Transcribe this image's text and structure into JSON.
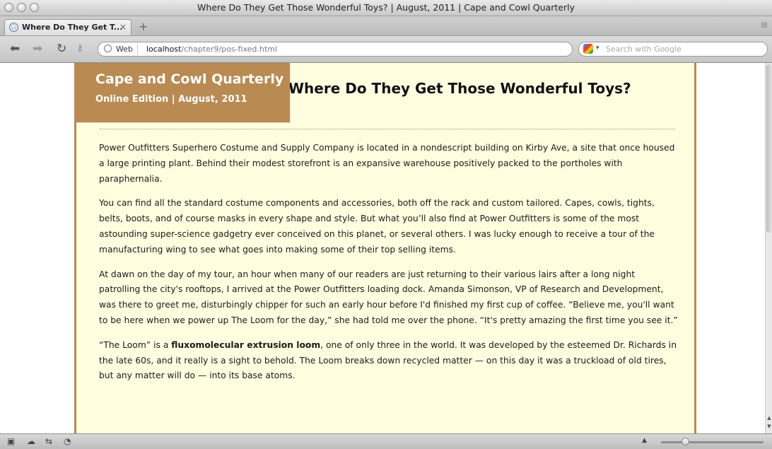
{
  "window": {
    "title": "Where Do They Get Those Wonderful Toys? | August, 2011 | Cape and Cowl Quarterly"
  },
  "tabs": [
    {
      "label": "Where Do They Get T...",
      "close": "×"
    }
  ],
  "tabbar": {
    "new_tab": "+"
  },
  "nav": {
    "back": "⬅",
    "forward": "➡",
    "reload": "↻",
    "site_badge": "Web",
    "url_host": "localhost",
    "url_path": "/chapter9/pos-fixed.html",
    "search_placeholder": "Search with Google"
  },
  "masthead": {
    "title": "Cape and Cowl Quarterly",
    "subtitle": "Online Edition | August, 2011"
  },
  "article": {
    "title": "Where Do They Get Those Wonderful Toys?",
    "paragraphs": [
      "Power Outfitters Superhero Costume and Supply Company is located in a nondescript building on Kirby Ave, a site that once housed a large printing plant. Behind their modest storefront is an expansive warehouse positively packed to the portholes with paraphernalia.",
      "You can find all the standard costume components and accessories, both off the rack and custom tailored. Capes, cowls, tights, belts, boots, and of course masks in every shape and style. But what you’ll also find at Power Outfitters is some of the most astounding super-science gadgetry ever conceived on this planet, or several others. I was lucky enough to receive a tour of the manufacturing wing to see what goes into making some of their top selling items.",
      "At dawn on the day of my tour, an hour when many of our readers are just returning to their various lairs after a long night patrolling the city's rooftops, I arrived at the Power Outfitters loading dock. Amanda Simonson, VP of Research and Development, was there to greet me, disturbingly chipper for such an early hour before I'd finished my first cup of coffee. “Believe me, you'll want to be here when we power up The Loom for the day,” she had told me over the phone. “It's pretty amazing the first time you see it.”"
    ],
    "p4_before": "“The Loom” is a ",
    "p4_bold": "fluxomolecular extrusion loom",
    "p4_after": ", one of only three in the world. It was developed by the esteemed Dr. Richards in the late 60s, and it really is a sight to behold. The Loom breaks down recycled matter — on this day it was a truckload of old tires, but any matter will do — into its base atoms."
  },
  "colors": {
    "accent": "#b98a52",
    "page_background": "#ffffe0"
  }
}
